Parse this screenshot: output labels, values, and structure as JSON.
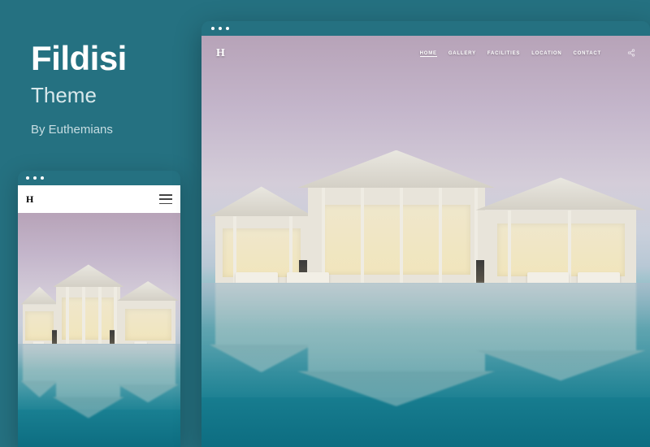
{
  "info": {
    "title": "Fildisi",
    "subtitle": "Theme",
    "author": "By Euthemians"
  },
  "nav": {
    "logo_text": "H",
    "items": [
      {
        "label": "HOME",
        "active": true
      },
      {
        "label": "GALLERY",
        "active": false
      },
      {
        "label": "FACILITIES",
        "active": false
      },
      {
        "label": "LOCATION",
        "active": false
      },
      {
        "label": "CONTACT",
        "active": false
      }
    ]
  },
  "mobile": {
    "logo_text": "H"
  }
}
